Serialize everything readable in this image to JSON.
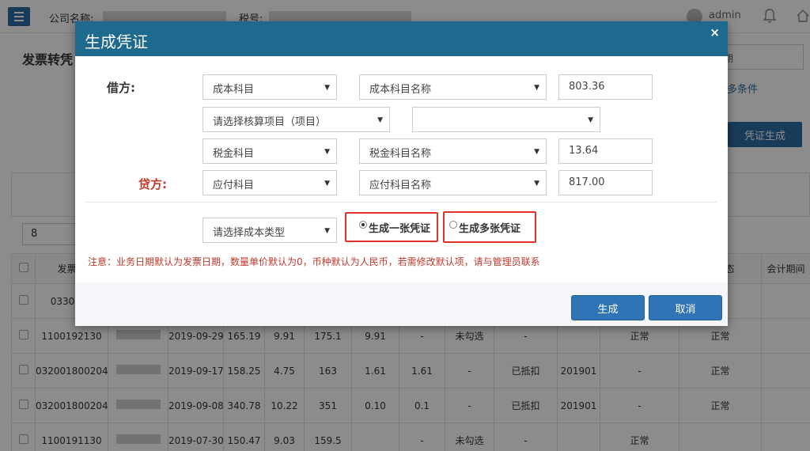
{
  "header": {
    "company_label": "公司名称:",
    "tax_label": "税号:",
    "user": "admin"
  },
  "page": {
    "title": "发票转凭",
    "filter_placeholder": "期",
    "more_conditions": "更多条件",
    "generate_button": "凭证生成",
    "pager_value": "8"
  },
  "table": {
    "headers": [
      "发票代",
      "",
      "",
      "",
      "",
      "",
      "",
      "",
      "",
      "",
      "",
      "",
      "凭状态",
      "会计期间"
    ],
    "rows": [
      [
        "0330019",
        "",
        "",
        "",
        "",
        "",
        "",
        "",
        "",
        "",
        "",
        "",
        "",
        ""
      ],
      [
        "1100192130",
        "",
        "2019-09-29",
        "165.19",
        "9.91",
        "175.1",
        "9.91",
        "-",
        "未勾选",
        "-",
        "",
        "正常",
        "正常",
        ""
      ],
      [
        "032001800204",
        "",
        "2019-09-17",
        "158.25",
        "4.75",
        "163",
        "1.61",
        "1.61",
        "-",
        "已抵扣",
        "201901",
        "-",
        "正常",
        ""
      ],
      [
        "032001800204",
        "",
        "2019-09-08",
        "340.78",
        "10.22",
        "351",
        "0.10",
        "0.1",
        "-",
        "已抵扣",
        "201901",
        "-",
        "正常",
        ""
      ],
      [
        "1100191130",
        "",
        "2019-07-30",
        "150.47",
        "9.03",
        "159.5",
        "",
        "-",
        "未勾选",
        "-",
        "",
        "正常",
        "",
        ""
      ]
    ]
  },
  "modal": {
    "title": "生成凭证",
    "close": "×",
    "debit_label": "借方:",
    "credit_label": "贷方:",
    "cost_subject": "成本科目",
    "cost_subject_name": "成本科目名称",
    "cost_amount": "803.36",
    "accounting_item": "请选择核算项目（项目）",
    "accounting_item_detail": "",
    "tax_subject": "税金科目",
    "tax_subject_name": "税金科目名称",
    "tax_amount": "13.64",
    "payable_subject": "应付科目",
    "payable_subject_name": "应付科目名称",
    "payable_amount": "817.00",
    "cost_type": "请选择成本类型",
    "radio_single": "生成一张凭证",
    "radio_multiple": "生成多张凭证",
    "note": "注意：业务日期默认为发票日期，数量单价默认为0，币种默认为人民币，若需修改默认项，请与管理员联系",
    "generate_button": "生成",
    "cancel_button": "取消"
  },
  "colors": {
    "header_bg": "#1d6a8e",
    "primary_button": "#2f74b5",
    "highlight_border": "#e0302a",
    "note_text": "#c0392b"
  }
}
